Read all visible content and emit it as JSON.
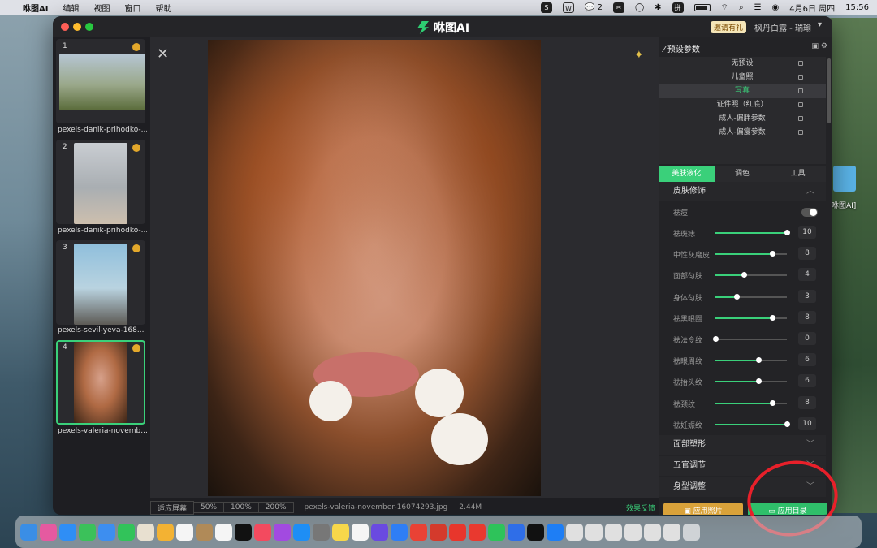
{
  "menubar": {
    "app_name": "咻图AI",
    "menus": [
      "编辑",
      "视图",
      "窗口",
      "帮助"
    ],
    "wechat_count": "2",
    "date": "4月6日 周四",
    "time": "15:56"
  },
  "window": {
    "title": "咻图AI",
    "invite": "邀请有礼",
    "user": "枫丹白露 - 瑞瑜"
  },
  "sidebar": {
    "items": [
      {
        "num": "1",
        "label": "pexels-danik-prihodko-..."
      },
      {
        "num": "2",
        "label": "pexels-danik-prihodko-..."
      },
      {
        "num": "3",
        "label": "pexels-sevil-yeva-168..."
      },
      {
        "num": "4",
        "label": "pexels-valeria-novemb..."
      }
    ]
  },
  "statusbar": {
    "fit": "适应屏幕",
    "z50": "50%",
    "z100": "100%",
    "z200": "200%",
    "file": "pexels-valeria-november-16074293.jpg",
    "size": "2.44M",
    "feedback": "效果反馈"
  },
  "panel": {
    "header": "预设参数",
    "presets": [
      "无预设",
      "儿童照",
      "写真",
      "证件照（红底）",
      "成人-偏胖参数",
      "成人-偏瘦参数"
    ],
    "active_preset": "写真",
    "tabs": [
      "美肤液化",
      "调色",
      "工具"
    ],
    "section_skin": "皮肤修饰",
    "acne_label": "祛痘",
    "sliders": [
      {
        "label": "祛斑痣",
        "value": "10",
        "fraction": 1.0
      },
      {
        "label": "中性灰磨皮",
        "value": "8",
        "fraction": 0.8
      },
      {
        "label": "面部匀肤",
        "value": "4",
        "fraction": 0.4
      },
      {
        "label": "身体匀肤",
        "value": "3",
        "fraction": 0.3
      },
      {
        "label": "祛黑眼圈",
        "value": "8",
        "fraction": 0.8
      },
      {
        "label": "祛法令纹",
        "value": "0",
        "fraction": 0.0
      },
      {
        "label": "祛眼周纹",
        "value": "6",
        "fraction": 0.6
      },
      {
        "label": "祛抬头纹",
        "value": "6",
        "fraction": 0.6
      },
      {
        "label": "祛颈纹",
        "value": "8",
        "fraction": 0.8
      },
      {
        "label": "祛妊娠纹",
        "value": "10",
        "fraction": 1.0
      }
    ],
    "section_face": "面部塑形",
    "section_features": "五官调节",
    "section_body": "身型调整",
    "btn_photo": "应用照片",
    "btn_dir": "应用目录"
  },
  "desktop": {
    "folder_label": "咻图AI]"
  }
}
